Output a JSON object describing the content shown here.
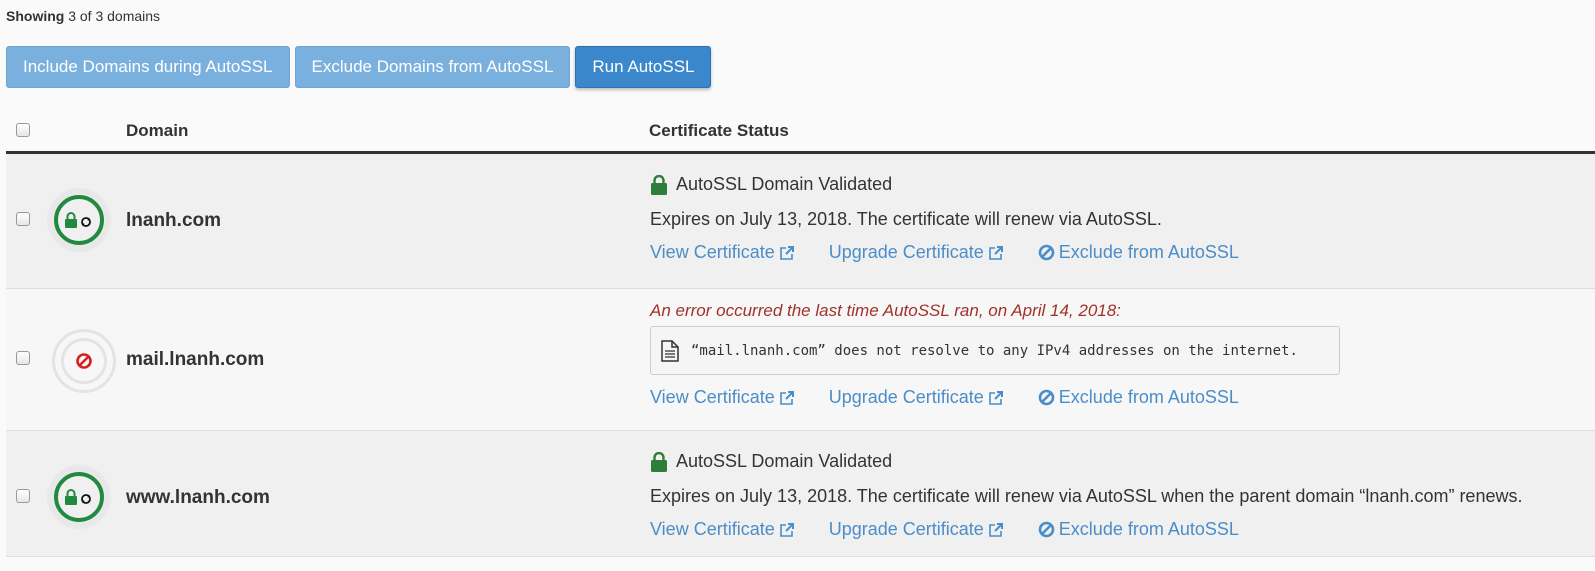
{
  "summary": {
    "showing_label": "Showing",
    "showing_text": "3 of 3 domains"
  },
  "toolbar": {
    "include_label": "Include Domains during AutoSSL",
    "exclude_label": "Exclude Domains from AutoSSL",
    "run_label": "Run AutoSSL"
  },
  "table": {
    "headers": {
      "domain": "Domain",
      "certificate_status": "Certificate Status"
    },
    "rows": [
      {
        "domain": "lnanh.com",
        "status_icon": "lock-sync-icon",
        "validated_text": "AutoSSL Domain Validated",
        "expires_text": "Expires on July 13, 2018. The certificate will renew via AutoSSL.",
        "view_label": "View Certificate",
        "upgrade_label": "Upgrade Certificate",
        "exclude_label": "Exclude from AutoSSL"
      },
      {
        "domain": "mail.lnanh.com",
        "status_icon": "ban-icon",
        "error_text": "An error occurred the last time AutoSSL ran, on April 14, 2018:",
        "error_detail": "“mail.lnanh.com” does not resolve to any IPv4 addresses on the internet.",
        "view_label": "View Certificate",
        "upgrade_label": "Upgrade Certificate",
        "exclude_label": "Exclude from AutoSSL"
      },
      {
        "domain": "www.lnanh.com",
        "status_icon": "lock-sync-icon",
        "validated_text": "AutoSSL Domain Validated",
        "expires_text": "Expires on July 13, 2018. The certificate will renew via AutoSSL when the parent domain “lnanh.com” renews.",
        "view_label": "View Certificate",
        "upgrade_label": "Upgrade Certificate",
        "exclude_label": "Exclude from AutoSSL"
      }
    ]
  },
  "colors": {
    "link": "#4b8dc8",
    "valid_green": "#218a3e",
    "error_red": "#a0322a",
    "primary_button": "#3a87cc",
    "secondary_button": "#7ab0de"
  }
}
